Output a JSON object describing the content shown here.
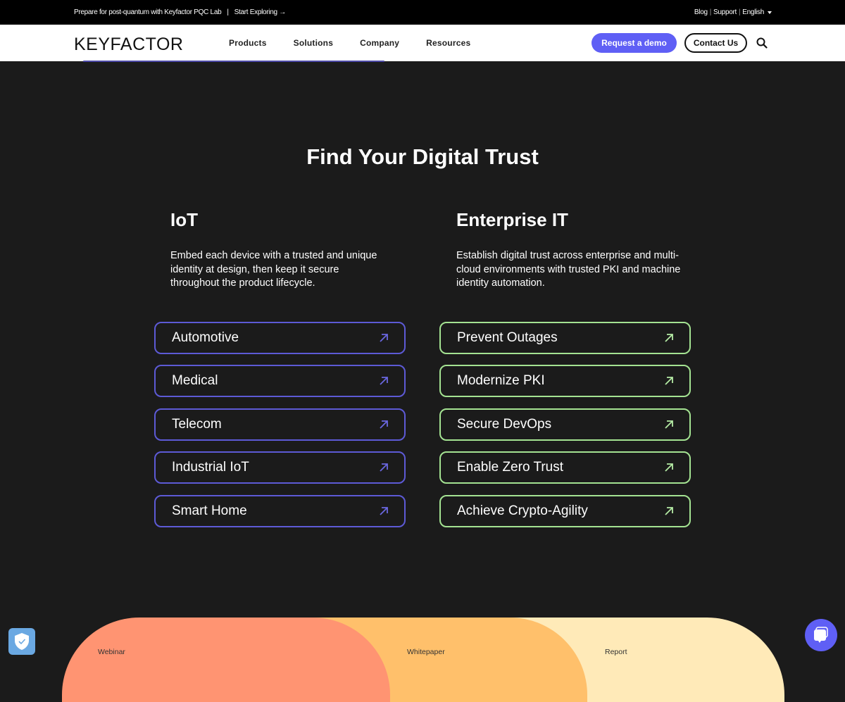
{
  "topbar": {
    "promo_text": "Prepare for post-quantum with Keyfactor PQC Lab",
    "promo_separator": "|",
    "promo_link": "Start Exploring →",
    "links": [
      "Blog",
      "Support",
      "English"
    ],
    "link_separator": "|"
  },
  "nav": {
    "logo": "KEYFACTOR",
    "items": [
      "Products",
      "Solutions",
      "Company",
      "Resources"
    ],
    "request_demo": "Request a demo",
    "contact_us": "Contact Us"
  },
  "section": {
    "title": "Find Your Digital Trust",
    "columns": [
      {
        "heading": "IoT",
        "description": "Embed each device with a trusted and unique identity at design, then keep it secure throughout the product lifecycle.",
        "links": [
          "Automotive",
          "Medical",
          "Telecom",
          "Industrial IoT",
          "Smart Home"
        ],
        "accent": "#5d5ad6"
      },
      {
        "heading": "Enterprise IT",
        "description": "Establish digital trust across enterprise and multi-cloud environments with trusted PKI and machine identity automation.",
        "links": [
          "Prevent Outages",
          "Modernize PKI",
          "Secure DevOps",
          "Enable Zero Trust",
          "Achieve Crypto-Agility"
        ],
        "accent": "#a4e392"
      }
    ]
  },
  "resources": {
    "items": [
      {
        "label": "Webinar",
        "color": "#ff9472"
      },
      {
        "label": "Whitepaper",
        "color": "#ffc06b"
      },
      {
        "label": "Report",
        "color": "#ffeab8"
      }
    ]
  },
  "colors": {
    "brand": "#5f5ff5",
    "background": "#1b1b1b"
  },
  "widgets": {
    "privacy_icon": "shield-check-icon",
    "chat_icon": "chat-bubbles-icon"
  }
}
